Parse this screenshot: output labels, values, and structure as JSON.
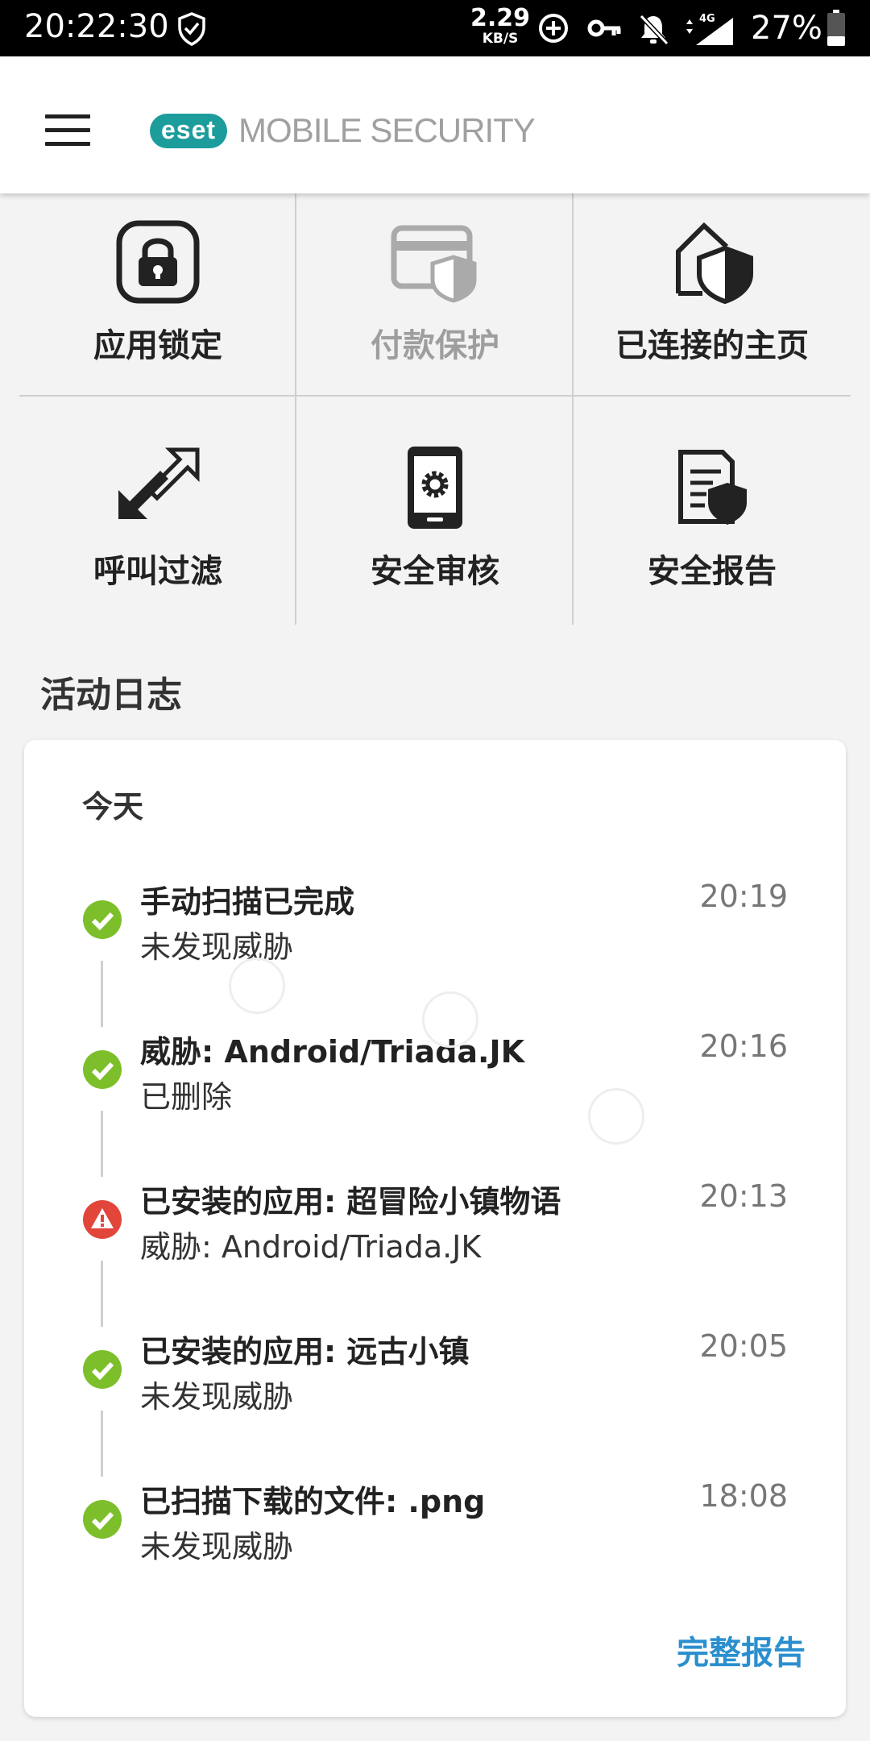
{
  "status_bar": {
    "time": "20:22:30",
    "net_speed": "2.29",
    "net_unit": "KB/S",
    "signal_type": "4G",
    "battery": "27%"
  },
  "app_bar": {
    "logo_brand": "eset",
    "logo_product": "MOBILE SECURITY"
  },
  "features": [
    {
      "label": "应用锁定",
      "icon": "lock-icon",
      "enabled": true
    },
    {
      "label": "付款保护",
      "icon": "payment-protection-icon",
      "enabled": false
    },
    {
      "label": "已连接的主页",
      "icon": "home-shield-icon",
      "enabled": true
    },
    {
      "label": "呼叫过滤",
      "icon": "call-filter-icon",
      "enabled": true
    },
    {
      "label": "安全审核",
      "icon": "phone-gear-icon",
      "enabled": true
    },
    {
      "label": "安全报告",
      "icon": "report-shield-icon",
      "enabled": true
    }
  ],
  "activity_log": {
    "title": "活动日志",
    "day_label": "今天",
    "entries": [
      {
        "title": "手动扫描已完成",
        "subtitle": "未发现威胁",
        "time": "20:19",
        "status": "ok"
      },
      {
        "title": "威胁: Android/Triada.JK",
        "subtitle": "已删除",
        "time": "20:16",
        "status": "ok"
      },
      {
        "title": "已安装的应用: 超冒险小镇物语",
        "subtitle": "威胁: Android/Triada.JK",
        "time": "20:13",
        "status": "warning"
      },
      {
        "title": "已安装的应用: 远古小镇",
        "subtitle": "未发现威胁",
        "time": "20:05",
        "status": "ok"
      },
      {
        "title": "已扫描下载的文件: .png",
        "subtitle": "未发现威胁",
        "time": "18:08",
        "status": "ok"
      }
    ],
    "full_report_label": "完整报告"
  },
  "colors": {
    "ok": "#7cbf2a",
    "warning": "#e2463b",
    "link": "#2b8fcf",
    "brand": "#1d9c9c"
  }
}
